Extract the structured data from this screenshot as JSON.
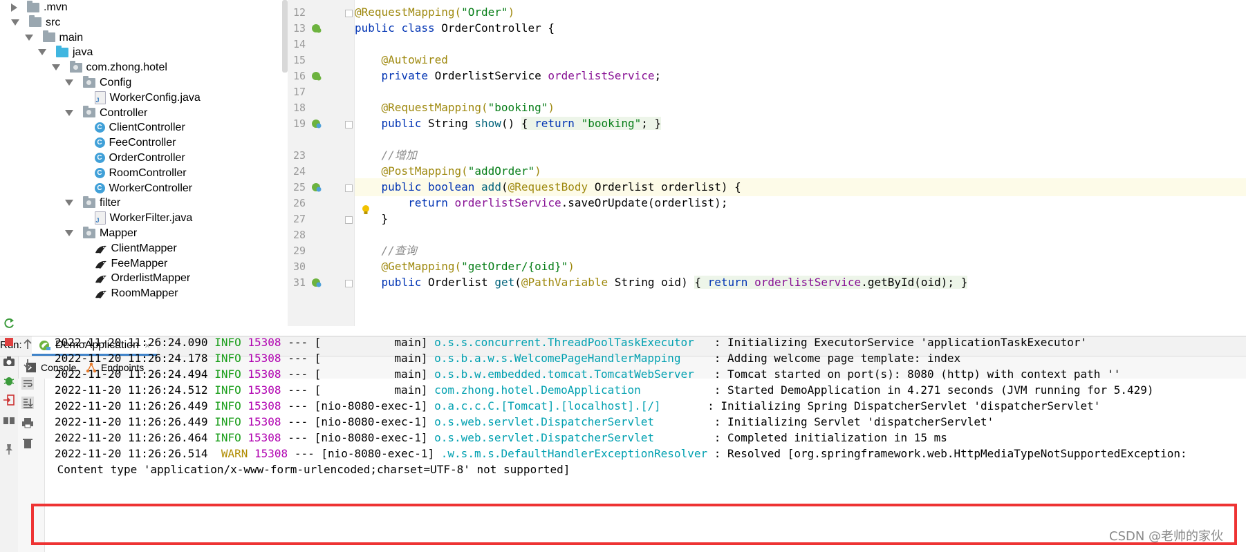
{
  "tree": {
    "items": [
      {
        "label": ".mvn",
        "icon": "folder-icon",
        "indent": 0,
        "arrow": "right"
      },
      {
        "label": "src",
        "icon": "folder-icon",
        "indent": 0,
        "arrow": "down"
      },
      {
        "label": "main",
        "icon": "folder-icon",
        "indent": 1,
        "arrow": "down"
      },
      {
        "label": "java",
        "icon": "source-folder-icon",
        "indent": 2,
        "arrow": "down"
      },
      {
        "label": "com.zhong.hotel",
        "icon": "package-icon",
        "indent": 3,
        "arrow": "down"
      },
      {
        "label": "Config",
        "icon": "package-icon",
        "indent": 4,
        "arrow": "down"
      },
      {
        "label": "WorkerConfig.java",
        "icon": "java-file-icon",
        "indent": 5,
        "arrow": "none"
      },
      {
        "label": "Controller",
        "icon": "package-icon",
        "indent": 4,
        "arrow": "down"
      },
      {
        "label": "ClientController",
        "icon": "class-icon",
        "indent": 5,
        "arrow": "none"
      },
      {
        "label": "FeeController",
        "icon": "class-icon",
        "indent": 5,
        "arrow": "none"
      },
      {
        "label": "OrderController",
        "icon": "class-icon",
        "indent": 5,
        "arrow": "none"
      },
      {
        "label": "RoomController",
        "icon": "class-icon",
        "indent": 5,
        "arrow": "none"
      },
      {
        "label": "WorkerController",
        "icon": "class-icon",
        "indent": 5,
        "arrow": "none"
      },
      {
        "label": "filter",
        "icon": "package-icon",
        "indent": 4,
        "arrow": "down"
      },
      {
        "label": "WorkerFilter.java",
        "icon": "java-file-icon",
        "indent": 5,
        "arrow": "none"
      },
      {
        "label": "Mapper",
        "icon": "package-icon",
        "indent": 4,
        "arrow": "down"
      },
      {
        "label": "ClientMapper",
        "icon": "mybatis-icon",
        "indent": 5,
        "arrow": "none"
      },
      {
        "label": "FeeMapper",
        "icon": "mybatis-icon",
        "indent": 5,
        "arrow": "none"
      },
      {
        "label": "OrderlistMapper",
        "icon": "mybatis-icon",
        "indent": 5,
        "arrow": "none"
      },
      {
        "label": "RoomMapper",
        "icon": "mybatis-icon",
        "indent": 5,
        "arrow": "none"
      }
    ]
  },
  "editor": {
    "lines": [
      {
        "n": "12",
        "gutter": "",
        "fold": true
      },
      {
        "n": "13",
        "gutter": "spring-bean-icon",
        "fold": false
      },
      {
        "n": "14",
        "gutter": "",
        "fold": false
      },
      {
        "n": "15",
        "gutter": "",
        "fold": false
      },
      {
        "n": "16",
        "gutter": "spring-bean-icon",
        "fold": false
      },
      {
        "n": "17",
        "gutter": "",
        "fold": false
      },
      {
        "n": "18",
        "gutter": "",
        "fold": false
      },
      {
        "n": "19",
        "gutter": "spring-web-icon",
        "fold": true
      },
      {
        "n": "23",
        "gutter": "",
        "fold": false
      },
      {
        "n": "23",
        "gutter": "",
        "fold": false
      },
      {
        "n": "24",
        "gutter": "",
        "fold": false
      },
      {
        "n": "25",
        "gutter": "spring-web-icon",
        "fold": true
      },
      {
        "n": "26",
        "gutter": "",
        "fold": false
      },
      {
        "n": "27",
        "gutter": "",
        "fold": true
      },
      {
        "n": "28",
        "gutter": "",
        "fold": false
      },
      {
        "n": "29",
        "gutter": "",
        "fold": false
      },
      {
        "n": "30",
        "gutter": "",
        "fold": false
      },
      {
        "n": "31",
        "gutter": "spring-web-icon",
        "fold": true
      }
    ],
    "code": {
      "l12_ann": "@RequestMapping(",
      "l12_str": "\"Order\"",
      "l12_end": ")",
      "l13_kw1": "public",
      "l13_kw2": "class",
      "l13_rest": "OrderController {",
      "l15_ann": "@Autowired",
      "l16_kw": "private",
      "l16_type": "OrderlistService",
      "l16_fld": "orderlistService",
      "l16_end": ";",
      "l18_ann": "@RequestMapping(",
      "l18_str": "\"booking\"",
      "l18_end": ")",
      "l19_kw": "public",
      "l19_type": "String",
      "l19_fn": "show",
      "l19_par": "()",
      "l19_b1": "{",
      "l19_ret": "return",
      "l19_str": "\"booking\"",
      "l19_semi": ";",
      "l19_b2": "}",
      "l23_cm": "//增加",
      "l24_ann": "@PostMapping(",
      "l24_str": "\"addOrder\"",
      "l24_end": ")",
      "l25_kw1": "public",
      "l25_kw2": "boolean",
      "l25_fn": "add",
      "l25_p": "(",
      "l25_ann": "@RequestBody",
      "l25_rest": "Orderlist orderlist) {",
      "l26_ret": "return",
      "l26_fld": "orderlistService",
      "l26_rest": ".saveOrUpdate(orderlist);",
      "l27": "}",
      "l29_cm": "//查询",
      "l30_ann": "@GetMapping(",
      "l30_str": "\"getOrder/{oid}\"",
      "l30_end": ")",
      "l31_kw": "public",
      "l31_type": "Orderlist",
      "l31_fn": "get",
      "l31_p": "(",
      "l31_ann": "@PathVariable",
      "l31_rest": "String oid)",
      "l31_b1": "{",
      "l31_ret": "return",
      "l31_fld": "orderlistService",
      "l31_call": ".getById(oid);",
      "l31_b2": "}"
    }
  },
  "run": {
    "label": "Run:",
    "tab": "DemoApplication",
    "close": "×",
    "subtabs": {
      "console": "Console",
      "endpoints": "Endpoints"
    }
  },
  "console": {
    "lines": [
      {
        "ts": "2022-11-20 11:26:24.090",
        "level": "INFO",
        "pid": "15308",
        "sep": "---",
        "thread": "[           main]",
        "logger": "o.s.s.concurrent.ThreadPoolTaskExecutor  ",
        "msg": ": Initializing ExecutorService 'applicationTaskExecutor'"
      },
      {
        "ts": "2022-11-20 11:26:24.178",
        "level": "INFO",
        "pid": "15308",
        "sep": "---",
        "thread": "[           main]",
        "logger": "o.s.b.a.w.s.WelcomePageHandlerMapping    ",
        "msg": ": Adding welcome page template: index"
      },
      {
        "ts": "2022-11-20 11:26:24.494",
        "level": "INFO",
        "pid": "15308",
        "sep": "---",
        "thread": "[           main]",
        "logger": "o.s.b.w.embedded.tomcat.TomcatWebServer  ",
        "msg": ": Tomcat started on port(s): 8080 (http) with context path ''"
      },
      {
        "ts": "2022-11-20 11:26:24.512",
        "level": "INFO",
        "pid": "15308",
        "sep": "---",
        "thread": "[           main]",
        "logger": "com.zhong.hotel.DemoApplication          ",
        "msg": ": Started DemoApplication in 4.271 seconds (JVM running for 5.429)"
      },
      {
        "ts": "2022-11-20 11:26:26.449",
        "level": "INFO",
        "pid": "15308",
        "sep": "---",
        "thread": "[nio-8080-exec-1]",
        "logger": "o.a.c.c.C.[Tomcat].[localhost].[/]      ",
        "msg": ": Initializing Spring DispatcherServlet 'dispatcherServlet'"
      },
      {
        "ts": "2022-11-20 11:26:26.449",
        "level": "INFO",
        "pid": "15308",
        "sep": "---",
        "thread": "[nio-8080-exec-1]",
        "logger": "o.s.web.servlet.DispatcherServlet        ",
        "msg": ": Initializing Servlet 'dispatcherServlet'"
      },
      {
        "ts": "2022-11-20 11:26:26.464",
        "level": "INFO",
        "pid": "15308",
        "sep": "---",
        "thread": "[nio-8080-exec-1]",
        "logger": "o.s.web.servlet.DispatcherServlet        ",
        "msg": ": Completed initialization in 15 ms"
      },
      {
        "ts": "2022-11-20 11:26:26.514",
        "level": " WARN",
        "pid": "15308",
        "sep": "---",
        "thread": "[nio-8080-exec-1]",
        "logger": ".w.s.m.s.DefaultHandlerExceptionResolver",
        "msg": ": Resolved [org.springframework.web.HttpMediaTypeNotSupportedException:"
      }
    ],
    "continuation": " Content type 'application/x-www-form-urlencoded;charset=UTF-8' not supported]"
  },
  "watermark": "CSDN @老帅的家伙",
  "colors": {
    "highlight_box": "#e33333",
    "tab_underline": "#4083c9"
  }
}
